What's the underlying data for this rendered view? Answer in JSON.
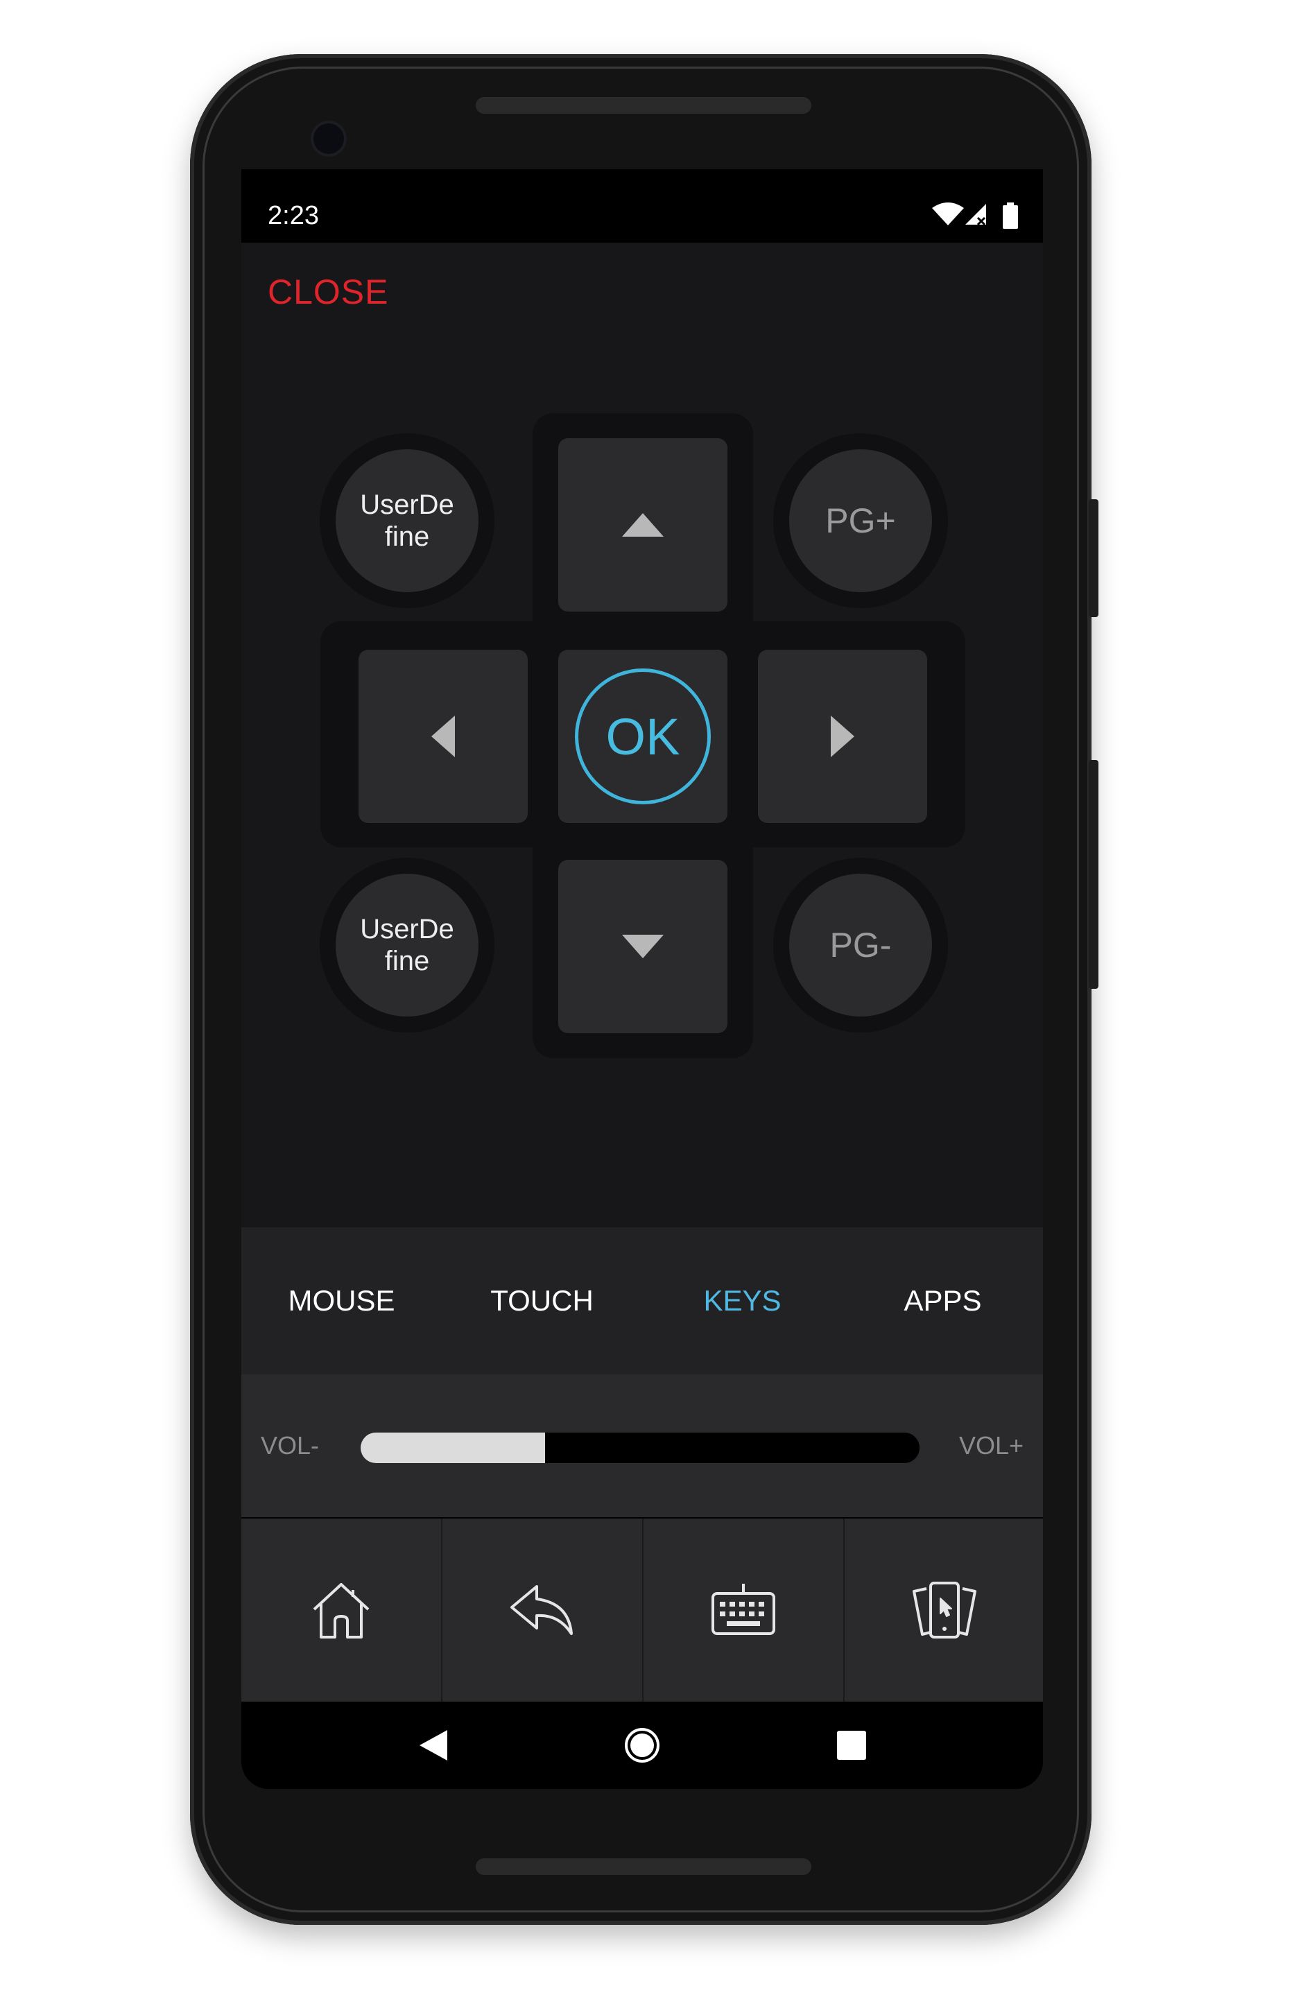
{
  "status_bar": {
    "time": "2:23",
    "icons": [
      "wifi-icon",
      "signal-icon",
      "battery-icon"
    ]
  },
  "header": {
    "close_label": "CLOSE"
  },
  "dpad": {
    "ok_label": "OK",
    "icons": {
      "up": "triangle-up-icon",
      "down": "triangle-down-icon",
      "left": "triangle-left-icon",
      "right": "triangle-right-icon"
    }
  },
  "round_keys": {
    "top_left": "UserDe fine",
    "bottom_left": "UserDe fine",
    "top_right": "PG+",
    "bottom_right": "PG-"
  },
  "tabs": [
    {
      "label": "MOUSE",
      "active": false
    },
    {
      "label": "TOUCH",
      "active": false
    },
    {
      "label": "KEYS",
      "active": true
    },
    {
      "label": "APPS",
      "active": false
    }
  ],
  "volume": {
    "minus_label": "VOL-",
    "plus_label": "VOL+",
    "level": 0.33
  },
  "actions": [
    {
      "icon": "home-icon"
    },
    {
      "icon": "back-arrow-icon"
    },
    {
      "icon": "keyboard-icon"
    },
    {
      "icon": "app-switcher-cards-icon"
    }
  ],
  "nav": {
    "icons": [
      "nav-back-icon",
      "nav-home-icon",
      "nav-recents-icon"
    ]
  },
  "colors": {
    "accent": "#4fb9e3",
    "close_red": "#e0242b",
    "background": "#171719",
    "key": "#2b2b2e"
  }
}
